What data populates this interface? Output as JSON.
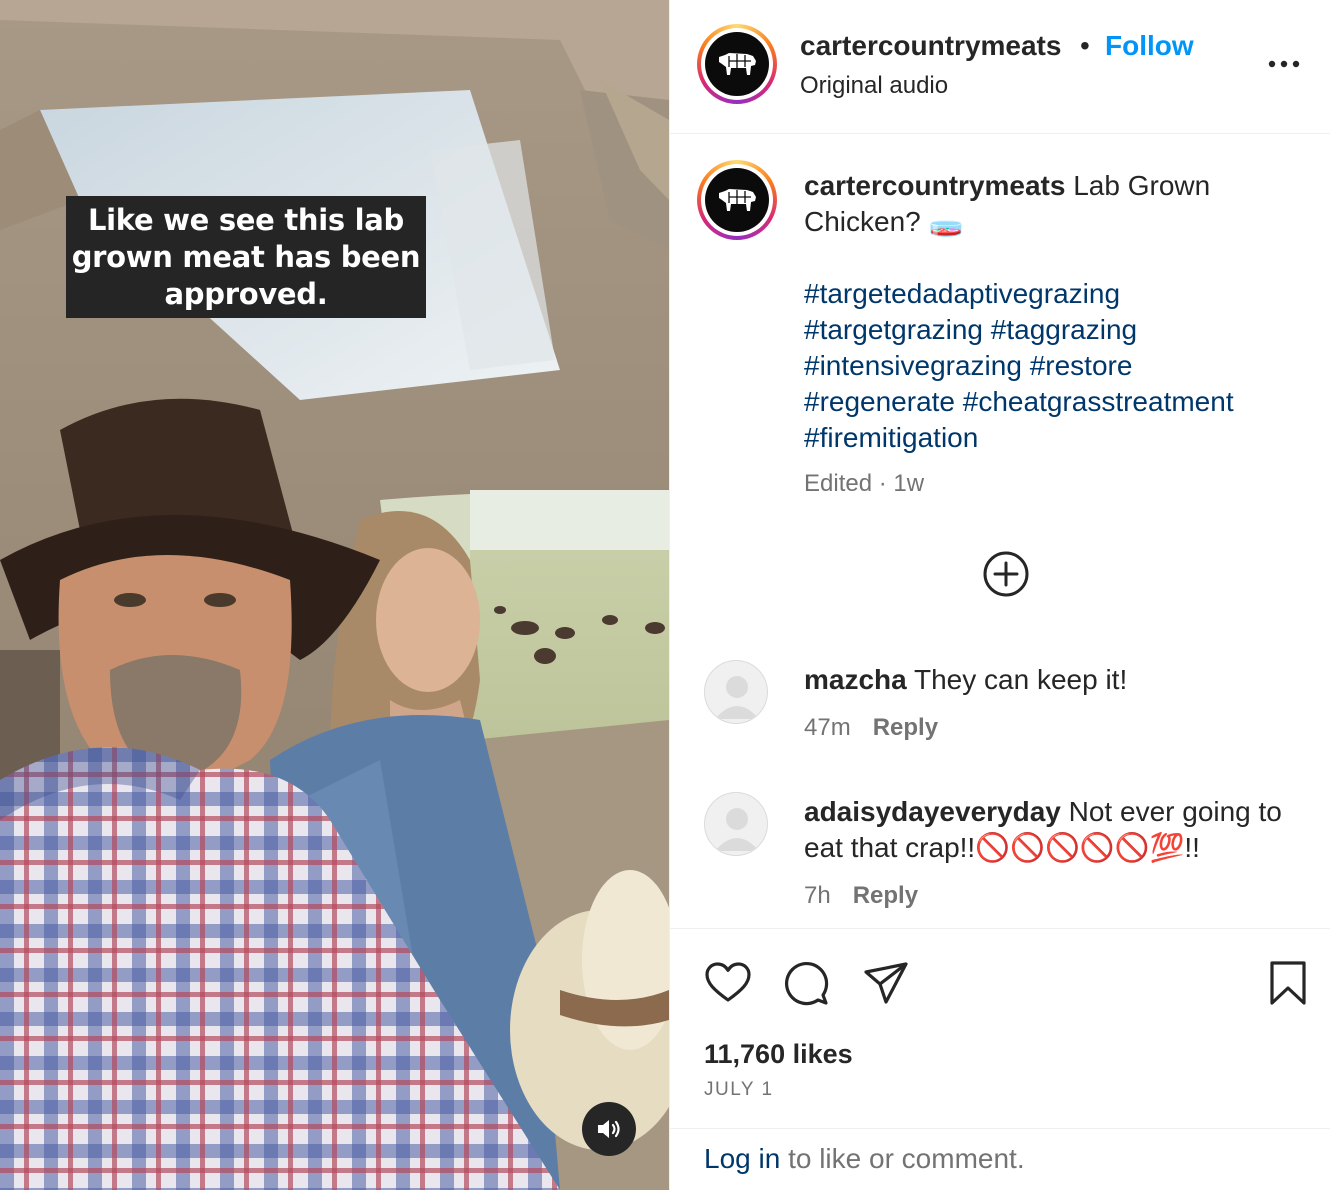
{
  "media": {
    "overlay_text": "Like we see this lab\ngrown meat has been\napproved.",
    "sound_icon": "speaker-icon"
  },
  "header": {
    "username": "cartercountrymeats",
    "separator": "•",
    "follow_label": "Follow",
    "subtitle": "Original audio",
    "more_icon": "more-options-icon"
  },
  "caption": {
    "username": "cartercountrymeats",
    "text": "Lab Grown Chicken?",
    "emoji": "🧫",
    "hashtags": [
      "#targetedadaptivegrazing",
      "#targetgrazing #taggrazing",
      "#intensivegrazing #restore",
      "#regenerate #cheatgrasstreatment",
      "#firemitigation"
    ],
    "edited": "Edited · 1w"
  },
  "load_more_icon": "plus-circle-icon",
  "comments": [
    {
      "username": "mazcha",
      "text": "They can keep it!",
      "time": "47m",
      "reply_label": "Reply"
    },
    {
      "username": "adaisydayeveryday",
      "text": "Not ever going to eat that crap!!🚫🚫🚫🚫🚫💯!!",
      "time": "7h",
      "reply_label": "Reply"
    }
  ],
  "actions": {
    "icons": [
      "heart-icon",
      "comment-icon",
      "share-icon",
      "bookmark-icon"
    ],
    "likes": "11,760 likes",
    "date": "JULY 1"
  },
  "login": {
    "link": "Log in",
    "rest": " to like or comment."
  },
  "colors": {
    "accent": "#0095f6",
    "hashtag": "#00376b",
    "muted": "#737373",
    "text": "#262626"
  }
}
